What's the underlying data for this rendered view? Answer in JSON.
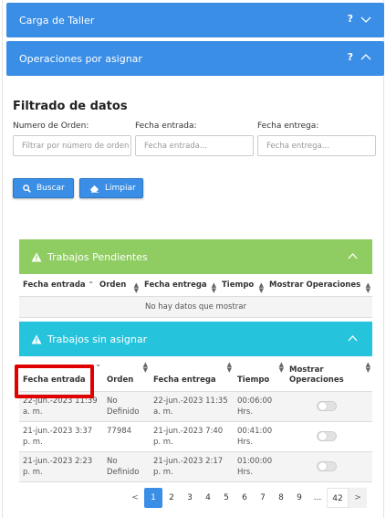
{
  "panels": {
    "carga": {
      "title": "Carga de Taller",
      "help": "?"
    },
    "operaciones": {
      "title": "Operaciones por asignar",
      "help": "?"
    }
  },
  "filter": {
    "title": "Filtrado de datos",
    "orden_label": "Numero de Orden:",
    "orden_placeholder": "Filtrar por número de orden",
    "entrada_label": "Fecha entrada:",
    "entrada_placeholder": "Fecha entrada...",
    "entrega_label": "Fecha entrega:",
    "entrega_placeholder": "Fecha entrega...",
    "buscar": "Buscar",
    "limpiar": "Limpiar"
  },
  "pendientes": {
    "title": "Trabajos Pendientes",
    "color": "#8fcd62",
    "columns": [
      "Fecha entrada",
      "Orden",
      "Fecha entrega",
      "Tiempo",
      "Mostrar Operaciones"
    ],
    "empty": "No hay datos que mostrar"
  },
  "sin_asignar": {
    "title": "Trabajos sin asignar",
    "color": "#26c3dc",
    "columns": [
      "Fecha entrada",
      "Orden",
      "Fecha entrega",
      "Tiempo",
      "Mostrar Operaciones"
    ],
    "rows": [
      {
        "entrada": "22-jun.-2023 11:39 a. m.",
        "orden": "No Definido",
        "entrega": "22-jun.-2023 11:35 a. m.",
        "tiempo": "00:06:00 Hrs."
      },
      {
        "entrada": "21-jun.-2023 3:37 p. m.",
        "orden": "77984",
        "entrega": "21-jun.-2023 7:40 p. m.",
        "tiempo": "00:41:00 Hrs."
      },
      {
        "entrada": "21-jun.-2023 2:23 p. m.",
        "orden": "No Definido",
        "entrega": "21-jun.-2023 2:17 p. m.",
        "tiempo": "01:00:00 Hrs."
      }
    ]
  },
  "pagination": {
    "prev": "<",
    "pages": [
      "1",
      "2",
      "3",
      "4",
      "5",
      "6",
      "7",
      "8",
      "9"
    ],
    "ellipsis": "...",
    "last": "42",
    "next": ">"
  }
}
